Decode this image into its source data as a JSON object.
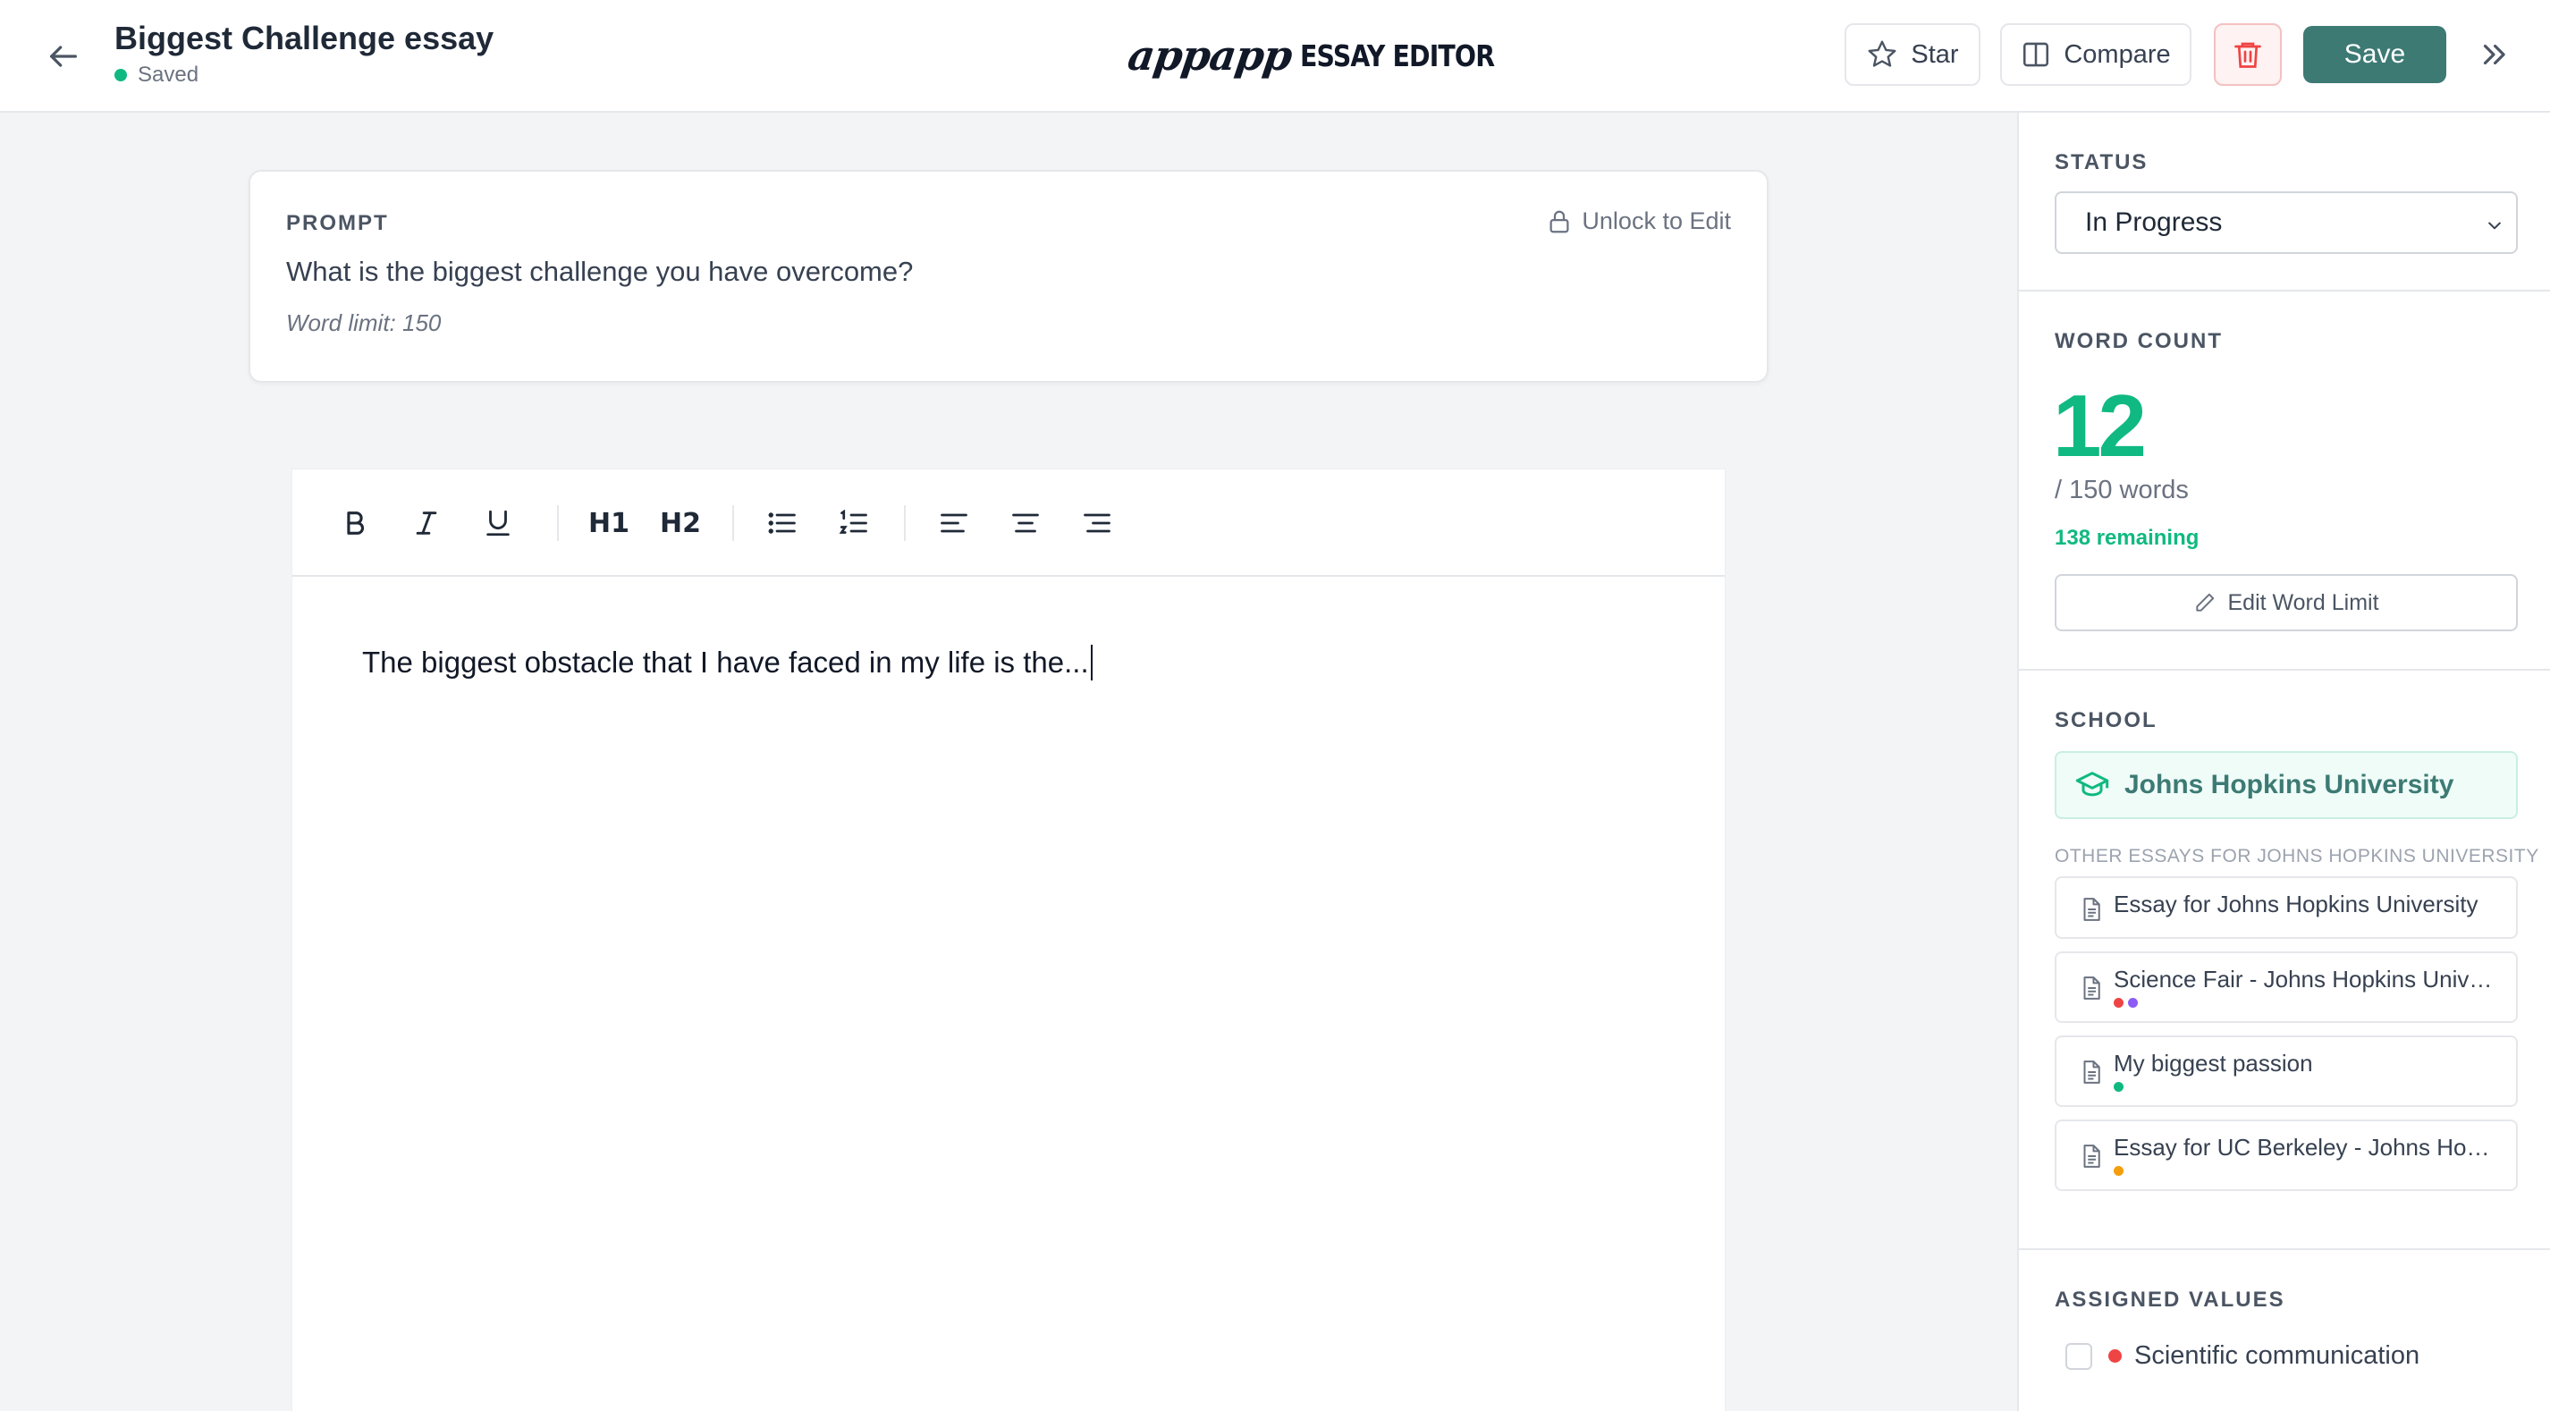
{
  "header": {
    "title": "Biggest Challenge essay",
    "save_state": "Saved",
    "brand_script": "appapp",
    "brand_text": "ESSAY EDITOR",
    "star_label": "Star",
    "compare_label": "Compare",
    "save_label": "Save"
  },
  "prompt": {
    "label": "PROMPT",
    "unlock_label": "Unlock to Edit",
    "text": "What is the biggest challenge you have overcome?",
    "word_limit": "Word limit: 150"
  },
  "editor": {
    "toolbar": {
      "h1": "H1",
      "h2": "H2"
    },
    "content": "The biggest obstacle that I have faced in my life is the..."
  },
  "sidebar": {
    "status": {
      "label": "STATUS",
      "selected": "In Progress"
    },
    "word_count": {
      "label": "WORD COUNT",
      "count": "12",
      "of_limit": "/ 150 words",
      "remaining": "138 remaining",
      "edit_label": "Edit Word Limit"
    },
    "school": {
      "label": "SCHOOL",
      "name": "Johns Hopkins University",
      "other_label": "OTHER ESSAYS FOR JOHNS HOPKINS UNIVERSITY",
      "essays": [
        {
          "title": "Essay for Johns Hopkins University",
          "dots": []
        },
        {
          "title": "Science Fair - Johns Hopkins University",
          "dots": [
            "#ef4444",
            "#8b5cf6"
          ]
        },
        {
          "title": "My biggest passion",
          "dots": [
            "#10b981"
          ]
        },
        {
          "title": "Essay for UC Berkeley - Johns Hopkins University",
          "dots": [
            "#f59e0b"
          ]
        }
      ]
    },
    "assigned_values": {
      "label": "ASSIGNED VALUES",
      "items": [
        {
          "label": "Scientific communication",
          "color": "#ef4444"
        }
      ]
    }
  },
  "colors": {
    "accent": "#3d7a74",
    "success": "#10b981",
    "danger": "#ef4444"
  }
}
